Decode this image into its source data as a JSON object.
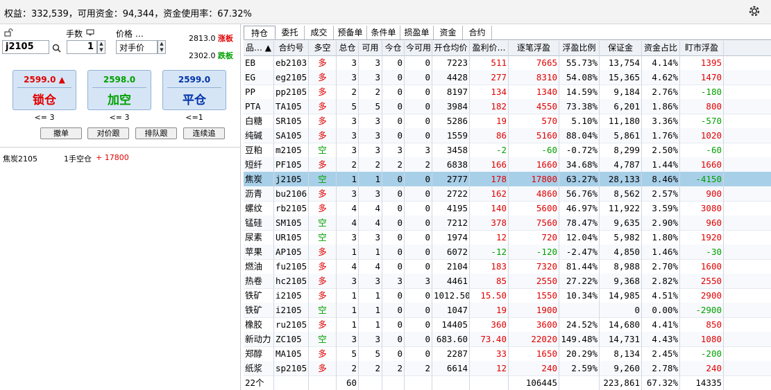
{
  "account": {
    "summary": "权益：332,539，可用资金：94,344，资金使用率：67.32%"
  },
  "order_panel": {
    "lots_label": "手数",
    "price_label": "价格 …",
    "contract": "j2105",
    "lots": "1",
    "price_type": "对手价",
    "upper_limit": "2813.0",
    "upper_limit_label": "涨板",
    "lower_limit": "2302.0",
    "lower_limit_label": "跌板",
    "buttons": [
      {
        "price": "2599.0",
        "action": "锁仓",
        "count": "<= 3",
        "color": "#e00000"
      },
      {
        "price": "2598.0",
        "action": "加空",
        "count": "<= 3",
        "color": "#00a000"
      },
      {
        "price": "2599.0",
        "action": "平仓",
        "count": "<=1",
        "color": "#0033aa"
      }
    ],
    "small_buttons": [
      "撤单",
      "对价跟",
      "排队跟",
      "连续追"
    ],
    "position_line": {
      "name": "焦炭2105",
      "desc": "1手空仓",
      "pnl": "+ 17800"
    }
  },
  "tabs": [
    "持仓",
    "委托",
    "成交",
    "预备单",
    "条件单",
    "损盈单",
    "资金",
    "合约"
  ],
  "table": {
    "headers": [
      "品… ▲",
      "合约号",
      "多空",
      "总仓",
      "可用",
      "今仓",
      "今可用",
      "开仓均价",
      "盈利价…",
      "逐笔浮盈",
      "浮盈比例",
      "保证金",
      "资金占比",
      "盯市浮盈"
    ],
    "rows": [
      [
        "EB",
        "eb2103",
        "多",
        "3",
        "3",
        "0",
        "0",
        "7223",
        "511",
        "7665",
        "55.73%",
        "13,754",
        "4.14%",
        "1395"
      ],
      [
        "EG",
        "eg2105",
        "多",
        "3",
        "3",
        "0",
        "0",
        "4428",
        "277",
        "8310",
        "54.08%",
        "15,365",
        "4.62%",
        "1470"
      ],
      [
        "PP",
        "pp2105",
        "多",
        "2",
        "2",
        "0",
        "0",
        "8197",
        "134",
        "1340",
        "14.59%",
        "9,184",
        "2.76%",
        "-180"
      ],
      [
        "PTA",
        "TA105",
        "多",
        "5",
        "5",
        "0",
        "0",
        "3984",
        "182",
        "4550",
        "73.38%",
        "6,201",
        "1.86%",
        "800"
      ],
      [
        "白糖",
        "SR105",
        "多",
        "3",
        "3",
        "0",
        "0",
        "5286",
        "19",
        "570",
        "5.10%",
        "11,180",
        "3.36%",
        "-570"
      ],
      [
        "纯碱",
        "SA105",
        "多",
        "3",
        "3",
        "0",
        "0",
        "1559",
        "86",
        "5160",
        "88.04%",
        "5,861",
        "1.76%",
        "1020"
      ],
      [
        "豆粕",
        "m2105",
        "空",
        "3",
        "3",
        "3",
        "3",
        "3458",
        "-2",
        "-60",
        "-0.72%",
        "8,299",
        "2.50%",
        "-60"
      ],
      [
        "短纤",
        "PF105",
        "多",
        "2",
        "2",
        "2",
        "2",
        "6838",
        "166",
        "1660",
        "34.68%",
        "4,787",
        "1.44%",
        "1660"
      ],
      [
        "焦炭",
        "j2105",
        "空",
        "1",
        "1",
        "0",
        "0",
        "2777",
        "178",
        "17800",
        "63.27%",
        "28,133",
        "8.46%",
        "-4150"
      ],
      [
        "沥青",
        "bu2106",
        "多",
        "3",
        "3",
        "0",
        "0",
        "2722",
        "162",
        "4860",
        "56.76%",
        "8,562",
        "2.57%",
        "900"
      ],
      [
        "螺纹",
        "rb2105",
        "多",
        "4",
        "4",
        "0",
        "0",
        "4195",
        "140",
        "5600",
        "46.97%",
        "11,922",
        "3.59%",
        "3080"
      ],
      [
        "锰硅",
        "SM105",
        "空",
        "4",
        "4",
        "0",
        "0",
        "7212",
        "378",
        "7560",
        "78.47%",
        "9,635",
        "2.90%",
        "960"
      ],
      [
        "尿素",
        "UR105",
        "空",
        "3",
        "3",
        "0",
        "0",
        "1974",
        "12",
        "720",
        "12.04%",
        "5,982",
        "1.80%",
        "1920"
      ],
      [
        "苹果",
        "AP105",
        "多",
        "1",
        "1",
        "0",
        "0",
        "6072",
        "-12",
        "-120",
        "-2.47%",
        "4,850",
        "1.46%",
        "-30"
      ],
      [
        "燃油",
        "fu2105",
        "多",
        "4",
        "4",
        "0",
        "0",
        "2104",
        "183",
        "7320",
        "81.44%",
        "8,988",
        "2.70%",
        "1600"
      ],
      [
        "热卷",
        "hc2105",
        "多",
        "3",
        "3",
        "3",
        "3",
        "4461",
        "85",
        "2550",
        "27.22%",
        "9,368",
        "2.82%",
        "2550"
      ],
      [
        "铁矿",
        "i2105",
        "多",
        "1",
        "1",
        "0",
        "0",
        "1012.50",
        "15.50",
        "1550",
        "10.34%",
        "14,985",
        "4.51%",
        "2900"
      ],
      [
        "铁矿",
        "i2105",
        "空",
        "1",
        "1",
        "0",
        "0",
        "1047",
        "19",
        "1900",
        "",
        "0",
        "0.00%",
        "-2900"
      ],
      [
        "橡胶",
        "ru2105",
        "多",
        "1",
        "1",
        "0",
        "0",
        "14405",
        "360",
        "3600",
        "24.52%",
        "14,680",
        "4.41%",
        "850"
      ],
      [
        "新动力",
        "ZC105",
        "空",
        "3",
        "3",
        "0",
        "0",
        "683.60",
        "73.40",
        "22020",
        "149.48%",
        "14,731",
        "4.43%",
        "1080"
      ],
      [
        "郑醇",
        "MA105",
        "多",
        "5",
        "5",
        "0",
        "0",
        "2287",
        "33",
        "1650",
        "20.29%",
        "8,134",
        "2.45%",
        "-200"
      ],
      [
        "纸浆",
        "sp2105",
        "多",
        "2",
        "2",
        "2",
        "2",
        "6614",
        "12",
        "240",
        "2.59%",
        "9,260",
        "2.78%",
        "240"
      ]
    ],
    "footer": [
      "22个",
      "",
      "",
      "60",
      "",
      "",
      "",
      "",
      "",
      "106445",
      "",
      "223,861",
      "67.32%",
      "14335"
    ],
    "selected_row": 8,
    "colors": {
      "profit": "#e00000",
      "loss": "#00a000",
      "selected": "#a8cfe8"
    }
  }
}
